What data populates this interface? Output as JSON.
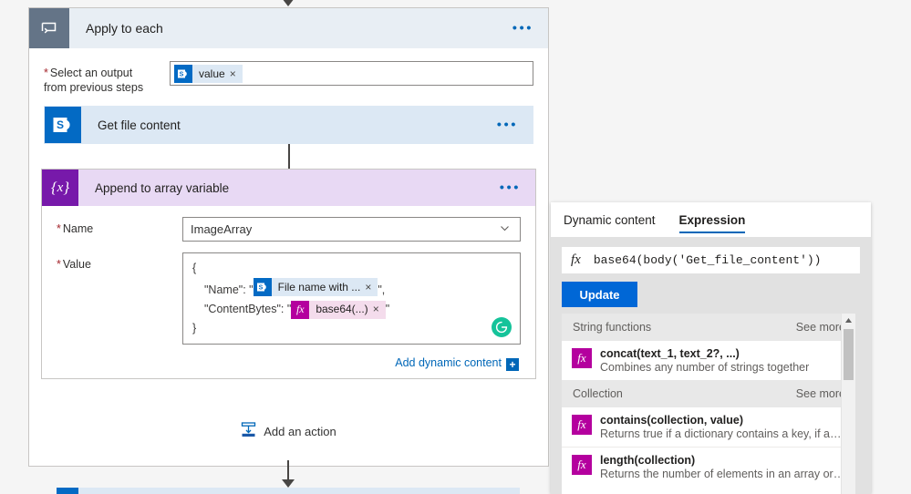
{
  "canvas": {
    "top_connector_arrow": "down-arrow"
  },
  "scope": {
    "icon": "loop-icon",
    "title": "Apply to each",
    "more_label": "•••",
    "select_output": {
      "label_line1": "Select an output",
      "label_line2": "from previous steps",
      "required_marker": "*",
      "token": {
        "icon": "sharepoint-icon",
        "label": "value",
        "remove": "×"
      }
    },
    "child_action": {
      "icon": "sharepoint-icon",
      "title": "Get file content",
      "more_label": "•••"
    },
    "add_action": {
      "icon": "insert-action-icon",
      "label": "Add an action"
    }
  },
  "append_card": {
    "icon": "variable-braces-icon",
    "title": "Append to array variable",
    "more_label": "•••",
    "name_field": {
      "required_marker": "*",
      "label": "Name",
      "value": "ImageArray",
      "chevron": "chevron-down-icon"
    },
    "value_field": {
      "required_marker": "*",
      "label": "Value",
      "line_open": "{",
      "line_close": "}",
      "name_key": "\"Name\": \"",
      "name_token": {
        "icon": "sharepoint-icon",
        "label": "File name with ...",
        "remove": "×"
      },
      "name_suffix": "\",",
      "contentbytes_key": "\"ContentBytes\": \"",
      "contentbytes_token": {
        "icon": "fx-icon",
        "label": "base64(...)",
        "remove": "×"
      },
      "contentbytes_suffix": "\"",
      "grammarly_icon": "grammarly-icon"
    },
    "add_dynamic_content": {
      "label": "Add dynamic content",
      "plus": "+"
    }
  },
  "dynamic_panel": {
    "tabs": [
      {
        "label": "Dynamic content",
        "active": false
      },
      {
        "label": "Expression",
        "active": true
      }
    ],
    "expression_input": {
      "fx_icon": "fx-icon",
      "value": "base64(body('Get_file_content'))"
    },
    "update_button": "Update",
    "scrollbar": {
      "up_arrow": "scroll-up-icon"
    },
    "groups": [
      {
        "name": "String functions",
        "see_more": "See more",
        "items": [
          {
            "icon": "fx-icon",
            "signature": "concat(text_1, text_2?, ...)",
            "description": "Combines any number of strings together"
          }
        ]
      },
      {
        "name": "Collection",
        "see_more": "See more",
        "items": [
          {
            "icon": "fx-icon",
            "signature": "contains(collection, value)",
            "description": "Returns true if a dictionary contains a key, if an array cont..."
          },
          {
            "icon": "fx-icon",
            "signature": "length(collection)",
            "description": "Returns the number of elements in an array or string"
          }
        ]
      }
    ]
  },
  "colors": {
    "sharepoint_blue": "#036ac4",
    "variable_purple": "#7719aa",
    "expression_magenta": "#b4009e",
    "link_blue": "#0067b8",
    "primary_button": "#0067d6",
    "scope_gray": "#647487",
    "grammarly_green": "#15c39a"
  }
}
